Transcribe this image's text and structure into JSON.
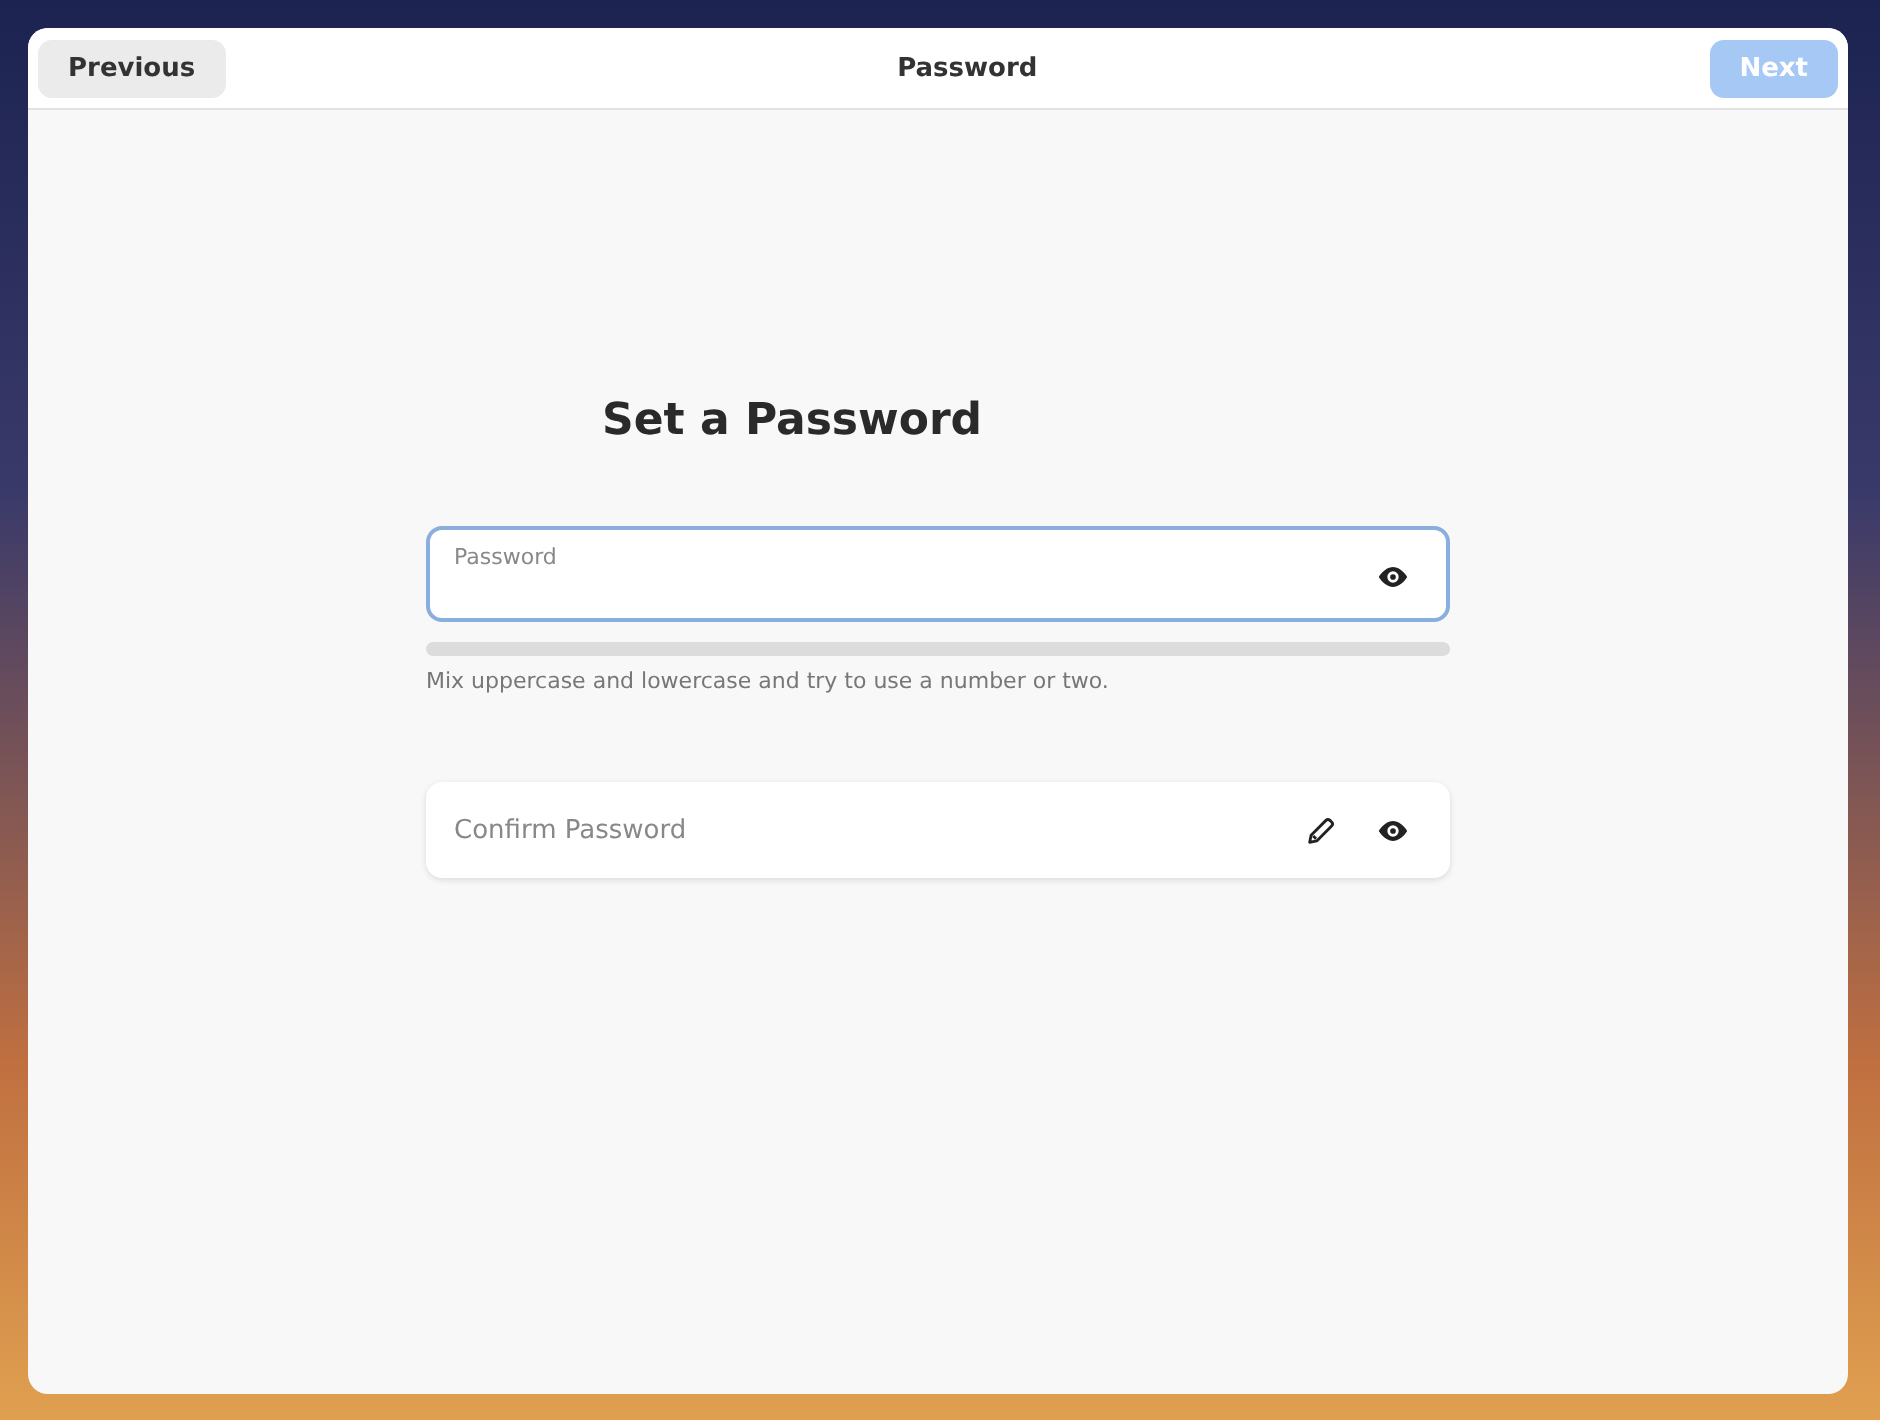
{
  "header": {
    "previous": "Previous",
    "title": "Password",
    "next": {
      "label": "Next",
      "disabled": true
    }
  },
  "heading": "Set a Password",
  "password": {
    "label": "Password",
    "focused": true,
    "level": 0
  },
  "hint": "Mix uppercase and lowercase and try to use a number or two.",
  "confirm": {
    "placeholder": "Confirm Password"
  }
}
